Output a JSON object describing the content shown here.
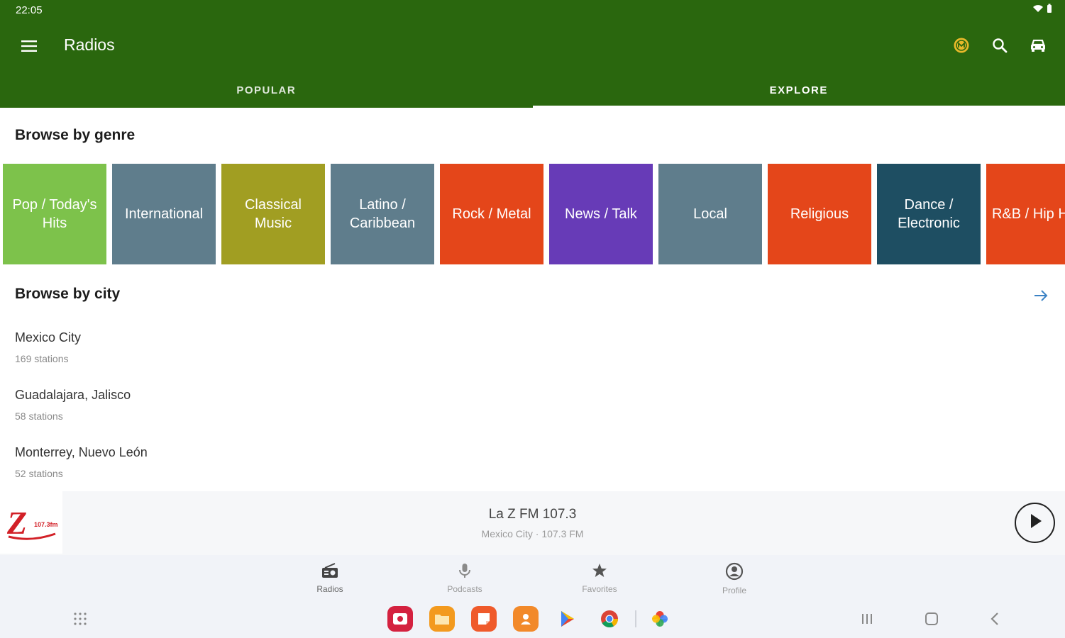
{
  "status_bar": {
    "time": "22:05"
  },
  "app_bar": {
    "title": "Radios",
    "tabs": [
      {
        "label": "POPULAR",
        "active": false
      },
      {
        "label": "EXPLORE",
        "active": true
      }
    ],
    "accent": "#2a670e",
    "actions": [
      "premium-badge-icon",
      "search-icon",
      "car-mode-icon"
    ]
  },
  "genres_section": {
    "title": "Browse by genre",
    "items": [
      {
        "label": "Pop / Today's Hits",
        "color": "#7dc24b"
      },
      {
        "label": "International",
        "color": "#5f7d8c"
      },
      {
        "label": "Classical Music",
        "color": "#a19e22"
      },
      {
        "label": "Latino / Caribbean",
        "color": "#5f7d8c"
      },
      {
        "label": "Rock / Metal",
        "color": "#e4461a"
      },
      {
        "label": "News / Talk",
        "color": "#673bb7"
      },
      {
        "label": "Local",
        "color": "#5f7d8c"
      },
      {
        "label": "Religious",
        "color": "#e4461a"
      },
      {
        "label": "Dance / Electronic",
        "color": "#1e4e62"
      },
      {
        "label": "R&B / Hip Hop",
        "color": "#e4461a"
      }
    ]
  },
  "cities_section": {
    "title": "Browse by city",
    "see_all_icon": "arrow-right-icon",
    "items": [
      {
        "name": "Mexico City",
        "count": "169 stations"
      },
      {
        "name": "Guadalajara, Jalisco",
        "count": "58 stations"
      },
      {
        "name": "Monterrey, Nuevo León",
        "count": "52 stations"
      }
    ]
  },
  "mini_player": {
    "station_name": "La Z FM 107.3",
    "subtitle": "Mexico City · 107.3 FM",
    "logo_text": "Z",
    "logo_small": "107.3fm"
  },
  "bottom_nav": {
    "items": [
      {
        "label": "Radios",
        "icon": "radio-icon",
        "active": true
      },
      {
        "label": "Podcasts",
        "icon": "microphone-icon",
        "active": false
      },
      {
        "label": "Favorites",
        "icon": "star-icon",
        "active": false
      },
      {
        "label": "Profile",
        "icon": "profile-icon",
        "active": false
      }
    ]
  },
  "system_nav": {
    "dock_apps": [
      "gallery-app-icon",
      "files-app-icon",
      "notes-app-icon",
      "contacts-app-icon",
      "play-store-app-icon",
      "chrome-app-icon",
      "photos-app-icon"
    ]
  }
}
